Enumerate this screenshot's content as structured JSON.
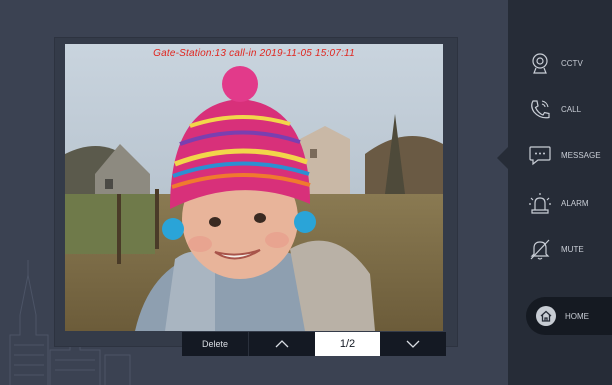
{
  "overlay": {
    "caption": "Gate-Station:13 call-in 2019-11-05 15:07:11"
  },
  "toolbar": {
    "delete_label": "Delete",
    "page_indicator": "1/2"
  },
  "sidebar": {
    "items": [
      {
        "label": "CCTV",
        "icon": "camera-icon"
      },
      {
        "label": "CALL",
        "icon": "phone-icon"
      },
      {
        "label": "MESSAGE",
        "icon": "message-icon"
      },
      {
        "label": "ALARM",
        "icon": "alarm-icon"
      },
      {
        "label": "MUTE",
        "icon": "mute-icon"
      }
    ],
    "home_label": "HOME"
  },
  "colors": {
    "caption": "#e0261f",
    "panel": "#3b4252",
    "sidebar": "#262c37",
    "toolbar": "#141923"
  }
}
